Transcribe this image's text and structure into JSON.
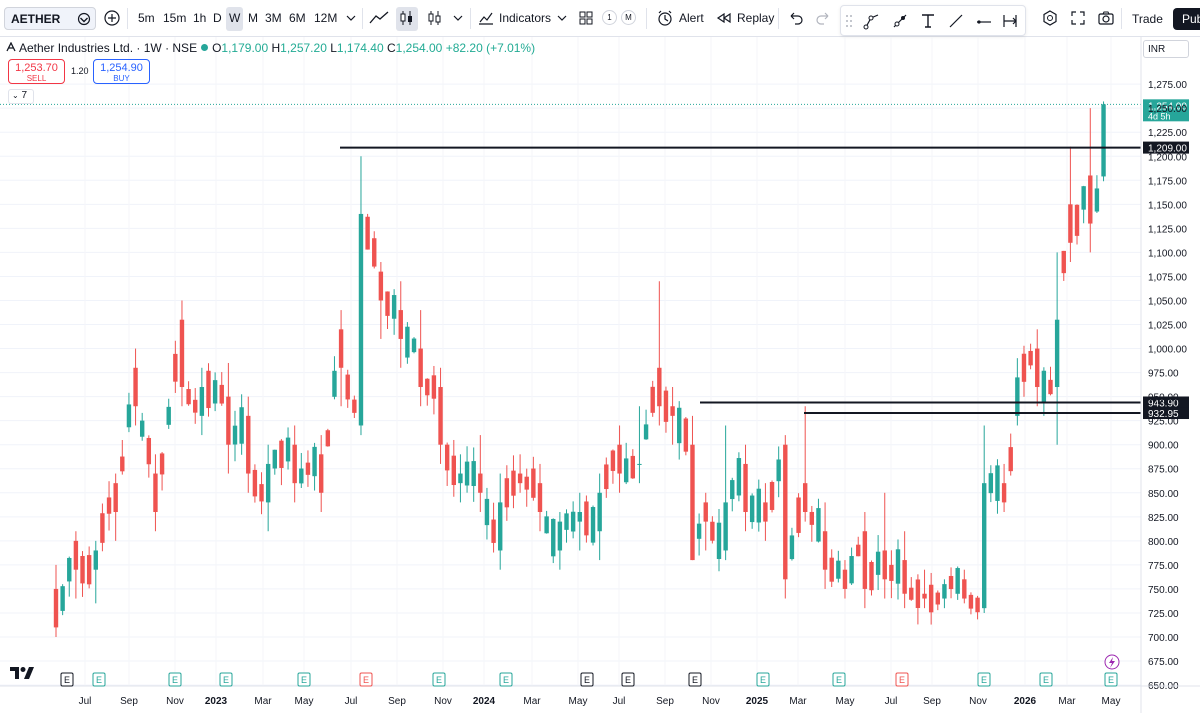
{
  "toolbar": {
    "symbol": "AETHER",
    "intervals": [
      "5m",
      "15m",
      "1h",
      "D",
      "W",
      "M",
      "3M",
      "6M",
      "12M"
    ],
    "selected_interval": "W",
    "indicators_label": "Indicators",
    "layout_badges": [
      "1",
      "M"
    ],
    "alert_label": "Alert",
    "replay_label": "Replay",
    "trade_label": "Trade",
    "publish_label": "Pub"
  },
  "legend": {
    "title": "Aether Industries Ltd. · 1W · NSE",
    "open_key": "O",
    "open": "1,179.00",
    "high_key": "H",
    "high": "1,257.20",
    "low_key": "L",
    "low": "1,174.40",
    "close_key": "C",
    "close": "1,254.00",
    "change": "+82.20 (+7.01%)"
  },
  "order": {
    "sell_price": "1,253.70",
    "sell_label": "SELL",
    "spread": "1.20",
    "buy_price": "1,254.90",
    "buy_label": "BUY"
  },
  "indicator_count": "7",
  "currency": "INR",
  "colors": {
    "up": "#26a69a",
    "down": "#ef5350",
    "line": "#131722",
    "last_price_bg": "#26a69a"
  },
  "chart_data": {
    "type": "candlestick",
    "price_ticks": [
      "1,275.00",
      "1,250.00",
      "1,225.00",
      "1,200.00",
      "1,175.00",
      "1,150.00",
      "1,125.00",
      "1,100.00",
      "1,075.00",
      "1,050.00",
      "1,025.00",
      "1,000.00",
      "975.00",
      "950.00",
      "925.00",
      "900.00",
      "875.00",
      "850.00",
      "825.00",
      "800.00",
      "775.00",
      "750.00",
      "725.00",
      "700.00",
      "675.00",
      "650.00"
    ],
    "time_ticks": [
      "Jul",
      "Sep",
      "Nov",
      "2023",
      "Mar",
      "May",
      "Jul",
      "Sep",
      "Nov",
      "2024",
      "Mar",
      "May",
      "Jul",
      "Sep",
      "Nov",
      "2025",
      "Mar",
      "May",
      "Jul",
      "Sep",
      "Nov",
      "2026",
      "Mar",
      "May"
    ],
    "horizontal_lines": [
      {
        "label": "1,209.00",
        "price": 1209.0
      },
      {
        "label": "943.90",
        "price": 943.9
      },
      {
        "label": "932.95",
        "price": 932.95
      }
    ],
    "last_price_label": "1,254.00",
    "countdown_label": "4d 5h",
    "earnings_markers": [
      {
        "glyph": "E",
        "style": "neutral"
      },
      {
        "glyph": "E",
        "style": "green"
      },
      {
        "glyph": "E",
        "style": "green"
      },
      {
        "glyph": "E",
        "style": "green"
      },
      {
        "glyph": "E",
        "style": "green"
      },
      {
        "glyph": "E",
        "style": "red"
      },
      {
        "glyph": "E",
        "style": "green"
      },
      {
        "glyph": "E",
        "style": "green"
      },
      {
        "glyph": "E",
        "style": "neutral"
      },
      {
        "glyph": "E",
        "style": "neutral"
      },
      {
        "glyph": "E",
        "style": "neutral"
      },
      {
        "glyph": "E",
        "style": "green"
      },
      {
        "glyph": "E",
        "style": "green"
      },
      {
        "glyph": "E",
        "style": "red"
      },
      {
        "glyph": "E",
        "style": "green"
      },
      {
        "glyph": "E",
        "style": "green"
      },
      {
        "glyph": "E",
        "style": "green"
      },
      {
        "glyph": "E",
        "style": "purple"
      }
    ],
    "ylim": [
      650,
      1280
    ],
    "anchors": [
      [
        0,
        750,
        710,
        775,
        700
      ],
      [
        3,
        800,
        770,
        810,
        740
      ],
      [
        6,
        770,
        790,
        800,
        735
      ],
      [
        9,
        860,
        830,
        870,
        800
      ],
      [
        12,
        980,
        940,
        1000,
        920
      ],
      [
        15,
        870,
        830,
        890,
        810
      ],
      [
        19,
        1030,
        960,
        1050,
        940
      ],
      [
        22,
        930,
        960,
        980,
        910
      ],
      [
        26,
        950,
        900,
        985,
        870
      ],
      [
        29,
        930,
        870,
        950,
        850
      ],
      [
        32,
        840,
        880,
        900,
        810
      ],
      [
        36,
        900,
        860,
        920,
        840
      ],
      [
        40,
        890,
        850,
        910,
        830
      ],
      [
        43,
        1020,
        980,
        1040,
        940
      ],
      [
        46,
        920,
        1140,
        1200,
        910
      ],
      [
        49,
        1080,
        1050,
        1090,
        1010
      ],
      [
        52,
        1040,
        1010,
        1070,
        980
      ],
      [
        55,
        1000,
        960,
        1040,
        940
      ],
      [
        58,
        960,
        900,
        980,
        880
      ],
      [
        61,
        860,
        870,
        890,
        840
      ],
      [
        64,
        870,
        850,
        910,
        830
      ],
      [
        67,
        790,
        840,
        870,
        770
      ],
      [
        70,
        870,
        860,
        890,
        850
      ],
      [
        73,
        860,
        830,
        880,
        810
      ],
      [
        76,
        790,
        820,
        830,
        770
      ],
      [
        79,
        820,
        830,
        850,
        790
      ],
      [
        82,
        810,
        850,
        870,
        780
      ],
      [
        85,
        900,
        870,
        920,
        850
      ],
      [
        88,
        880,
        880,
        940,
        860
      ],
      [
        91,
        980,
        940,
        1070,
        920
      ],
      [
        93,
        940,
        930,
        960,
        900
      ],
      [
        96,
        900,
        780,
        930,
        780
      ],
      [
        98,
        840,
        820,
        850,
        790
      ],
      [
        101,
        790,
        840,
        920,
        780
      ],
      [
        104,
        880,
        830,
        900,
        810
      ],
      [
        107,
        840,
        820,
        860,
        800
      ],
      [
        110,
        900,
        760,
        910,
        740
      ],
      [
        113,
        860,
        830,
        940,
        820
      ],
      [
        116,
        810,
        770,
        840,
        750
      ],
      [
        119,
        770,
        750,
        780,
        740
      ],
      [
        122,
        810,
        750,
        830,
        730
      ],
      [
        125,
        790,
        760,
        850,
        740
      ],
      [
        128,
        780,
        745,
        810,
        730
      ],
      [
        131,
        745,
        740,
        770,
        730
      ],
      [
        134,
        740,
        755,
        760,
        730
      ],
      [
        137,
        760,
        740,
        770,
        735
      ],
      [
        140,
        730,
        860,
        920,
        725
      ],
      [
        143,
        860,
        840,
        880,
        830
      ],
      [
        145,
        930,
        970,
        990,
        920
      ],
      [
        148,
        1000,
        960,
        1020,
        940
      ],
      [
        151,
        960,
        1030,
        1100,
        900
      ],
      [
        153,
        1150,
        1110,
        1210,
        1090
      ],
      [
        156,
        1180,
        1130,
        1250,
        1100
      ],
      [
        158,
        1179,
        1254,
        1257,
        1174
      ]
    ]
  }
}
